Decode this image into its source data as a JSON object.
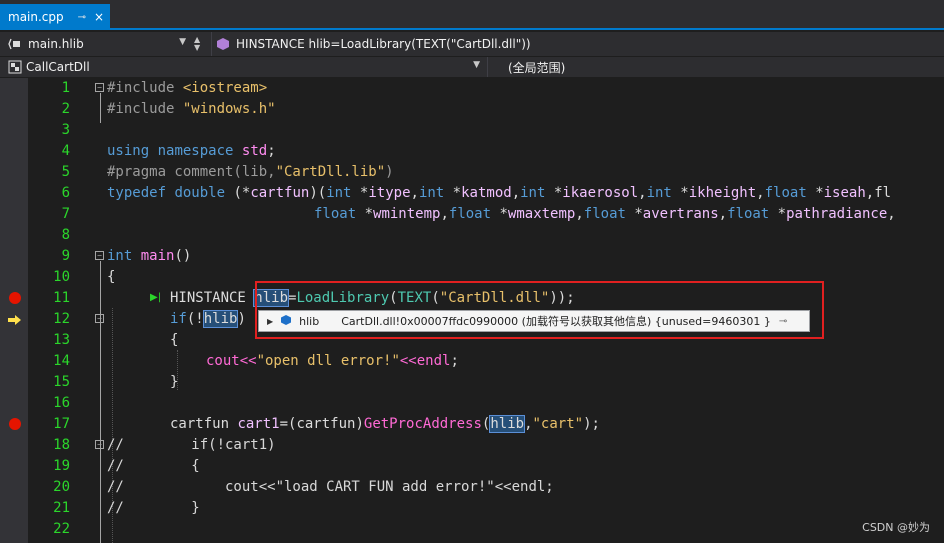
{
  "tab": {
    "title": "main.cpp",
    "pin": "⊸",
    "close": "×"
  },
  "nav1": {
    "scope": "main.hlib",
    "member": "HINSTANCE hlib=LoadLibrary(TEXT(\"CartDll.dll\"))"
  },
  "nav2": {
    "project": "CallCartDll",
    "scope": "(全局范围)"
  },
  "lines": {
    "l1": "1",
    "l2": "2",
    "l3": "3",
    "l4": "4",
    "l5": "5",
    "l6": "6",
    "l7": "7",
    "l8": "8",
    "l9": "9",
    "l10": "10",
    "l11": "11",
    "l12": "12",
    "l13": "13",
    "l14": "14",
    "l15": "15",
    "l16": "16",
    "l17": "17",
    "l18": "18",
    "l19": "19",
    "l20": "20",
    "l21": "21",
    "l22": "22"
  },
  "code": {
    "c1a": "#include ",
    "c1b": "<iostream>",
    "c2a": "#include ",
    "c2b": "\"windows.h\"",
    "c4a": "using",
    "c4b": " ",
    "c4c": "namespace",
    "c4d": " ",
    "c4e": "std",
    "c4f": ";",
    "c5a": "#pragma comment(lib,",
    "c5b": "\"CartDll.lib\"",
    "c5c": ")",
    "c6a": "typedef",
    "c6b": " ",
    "c6c": "double",
    "c6d": " (*",
    "c6e": "cartfun",
    "c6f": ")(",
    "c6g": "int",
    "c6h": " *",
    "c6i": "itype",
    "c6j": ",",
    "c6k": "int",
    "c6l": " *",
    "c6m": "katmod",
    "c6n": ",",
    "c6o": "int",
    "c6p": " *",
    "c6q": "ikaerosol",
    "c6r": ",",
    "c6s": "int",
    "c6t": " *",
    "c6u": "ikheight",
    "c6v": ",",
    "c6w": "float",
    "c6x": " *",
    "c6y": "iseah",
    "c6z": ",fl",
    "c7a": "float",
    "c7b": " *",
    "c7c": "wmintemp",
    "c7d": ",",
    "c7e": "float",
    "c7f": " *",
    "c7g": "wmaxtemp",
    "c7h": ",",
    "c7i": "float",
    "c7j": " *",
    "c7k": "avertrans",
    "c7l": ",",
    "c7m": "float",
    "c7n": " *",
    "c7o": "pathradiance",
    "c7p": ",",
    "c9a": "int",
    "c9b": " ",
    "c9c": "main",
    "c9d": "()",
    "c10": "{",
    "c11a": "HINSTANCE ",
    "c11b": "hlib",
    "c11c": "=",
    "c11d": "LoadLibrary",
    "c11e": "(",
    "c11f": "TEXT",
    "c11g": "(",
    "c11h": "\"CartDll.dll\"",
    "c11i": "));",
    "c12a": "if",
    "c12b": "(!",
    "c12c": "hlib",
    "c12d": ")",
    "c13": "{",
    "c14a": "cout",
    "c14b": "<<",
    "c14c": "\"open dll error!\"",
    "c14d": "<<",
    "c14e": "endl",
    "c14f": ";",
    "c15": "}",
    "c17a": "cartfun ",
    "c17b": "cart1",
    "c17c": "=(cartfun)",
    "c17d": "GetProcAddress",
    "c17e": "(",
    "c17f": "hlib",
    "c17g": ",",
    "c17h": "\"cart\"",
    "c17i": ");",
    "c18a": "//",
    "c18b": "        if(!cart1)",
    "c19a": "//",
    "c19b": "        {",
    "c20a": "//",
    "c20b": "            cout<<\"load CART FUN add error!\"<<endl;",
    "c21a": "//",
    "c21b": "        }"
  },
  "datatip": {
    "expand": "▶",
    "name": "hlib",
    "value": "CartDll.dll!0x00007ffdc0990000 (加载符号以获取其他信息) {unused=9460301 }",
    "pin": "⊸"
  },
  "watermark": "CSDN @妙为",
  "colors": {
    "accent": "#007acc",
    "breakpoint": "#e51400",
    "linenumber": "#2bd62b",
    "highlight_box": "#e02020"
  }
}
